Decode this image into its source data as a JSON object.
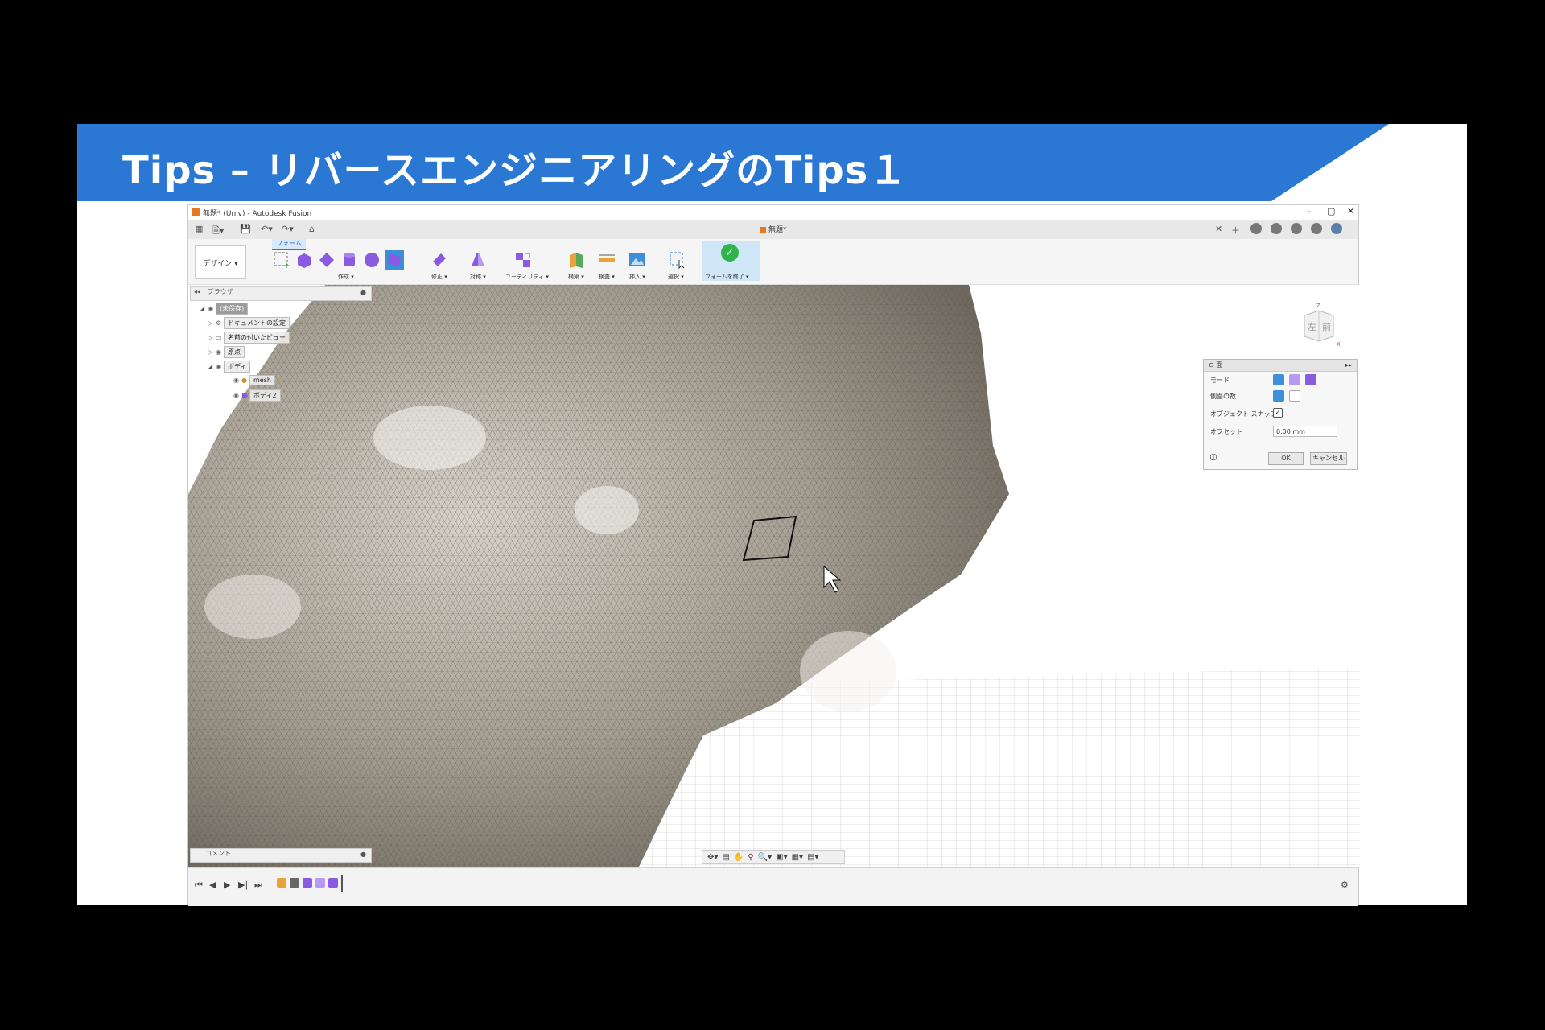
{
  "slide": {
    "title": "Tips – リバースエンジニアリングのTips１",
    "banner_color": "#2a78d4"
  },
  "window": {
    "title": "無題* (Univ) - Autodesk Fusion",
    "doc_tab": "無題*",
    "controls": [
      "–",
      "▢",
      "✕"
    ]
  },
  "ribbon": {
    "workspace": "デザイン ▾",
    "active_tab": "フォーム",
    "groups": [
      "作成 ▾",
      "修正 ▾",
      "対称 ▾",
      "ユーティリティ ▾",
      "構築 ▾",
      "検査 ▾",
      "挿入 ▾",
      "選択 ▾"
    ],
    "finish_label": "フォームを終了 ▾"
  },
  "browser": {
    "title": "ブラウザ",
    "items": [
      {
        "label": "(未保存)"
      },
      {
        "label": "ドキュメントの設定"
      },
      {
        "label": "名前の付いたビュー"
      },
      {
        "label": "原点"
      },
      {
        "label": "ボディ"
      },
      {
        "label": "mesh"
      },
      {
        "label": "ボディ2"
      }
    ]
  },
  "dialog": {
    "title": "面",
    "mode_label": "モード",
    "sides_label": "側面の数",
    "snap_label": "オブジェクト スナップ",
    "offset_label": "オフセット",
    "offset_value": "0.00 mm",
    "ok": "OK",
    "cancel": "キャンセル"
  },
  "viewcube": {
    "left": "左",
    "front": "前",
    "axis_z": "Z",
    "axis_x": "X"
  },
  "comment": {
    "label": "コメント"
  },
  "colors": {
    "accent": "#2a78d4",
    "mesh": "#a8a296",
    "finish": "#2fb34a"
  }
}
